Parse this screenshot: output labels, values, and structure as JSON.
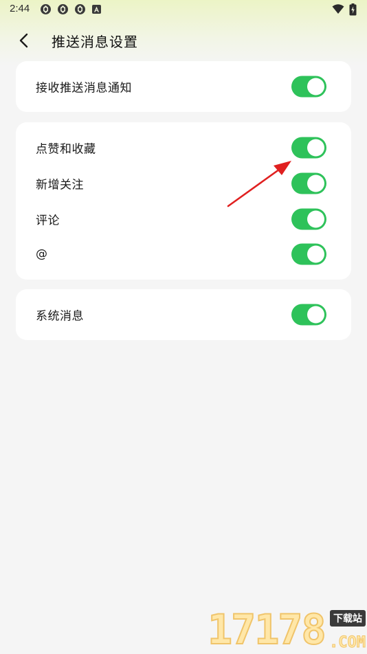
{
  "status_bar": {
    "time": "2:44",
    "icons": [
      "aperture-icon",
      "aperture-icon",
      "aperture-icon",
      "a-badge-icon"
    ],
    "right_icons": [
      "wifi-icon",
      "battery-icon"
    ]
  },
  "header": {
    "title": "推送消息设置",
    "back_icon": "chevron-left-icon"
  },
  "cards": [
    {
      "rows": [
        {
          "label": "接收推送消息通知",
          "enabled": true
        }
      ]
    },
    {
      "rows": [
        {
          "label": "点赞和收藏",
          "enabled": true
        },
        {
          "label": "新增关注",
          "enabled": true
        },
        {
          "label": "评论",
          "enabled": true
        },
        {
          "label": "@",
          "enabled": true
        }
      ]
    },
    {
      "rows": [
        {
          "label": "系统消息",
          "enabled": true
        }
      ]
    }
  ],
  "annotation": {
    "arrow_color": "#e02020"
  },
  "watermark": {
    "numbers": "17178",
    "badge": "下载站",
    "domain": ".COM"
  },
  "colors": {
    "toggle_on": "#2ec25a",
    "background": "#f5f5f5",
    "card": "#ffffff"
  }
}
